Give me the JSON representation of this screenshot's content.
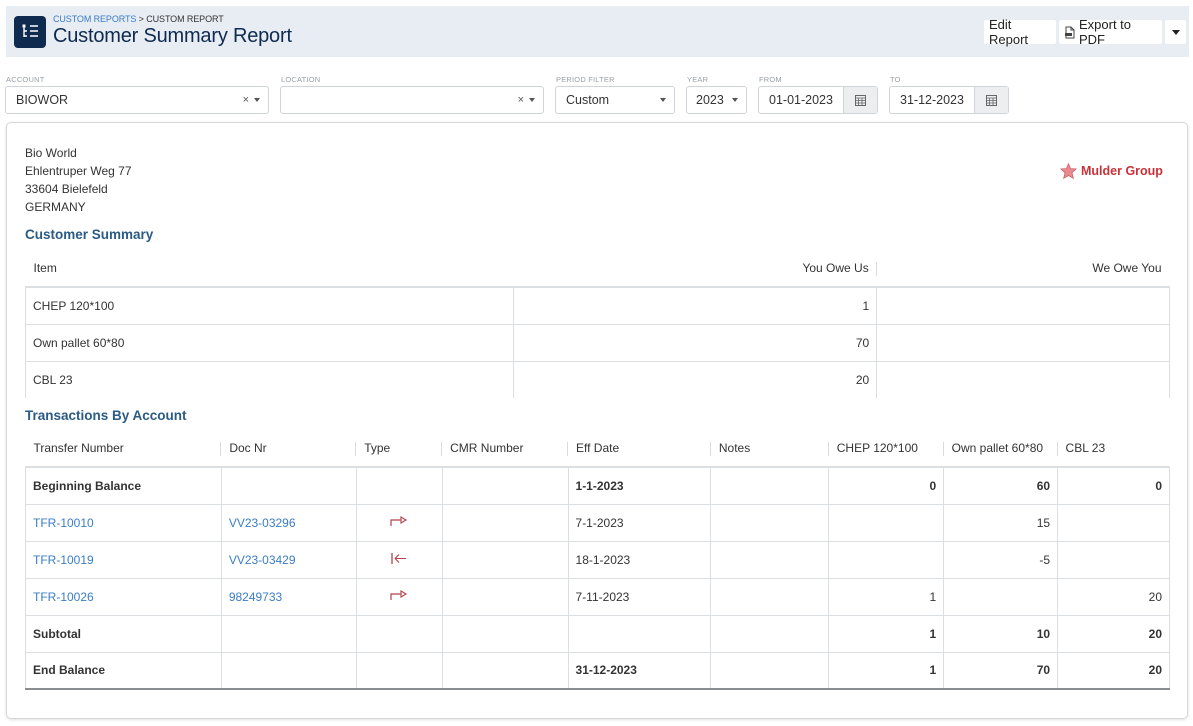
{
  "header": {
    "breadcrumb": {
      "parent": "CUSTOM REPORTS",
      "separator": " > ",
      "current": "CUSTOM REPORT"
    },
    "title": "Customer Summary Report",
    "app_icon": "tree-list-icon",
    "buttons": {
      "edit": "Edit Report",
      "export": "Export to PDF",
      "export_icon": "pdf-file-icon",
      "more_icon": "caret-down-icon"
    }
  },
  "filters": {
    "account": {
      "label": "ACCOUNT",
      "value": "BIOWOR",
      "clear_symbol": "×"
    },
    "location": {
      "label": "LOCATION",
      "value": "",
      "clear_symbol": "×"
    },
    "period": {
      "label": "PERIOD FILTER",
      "value": "Custom"
    },
    "year": {
      "label": "YEAR",
      "value": "2023"
    },
    "from": {
      "label": "FROM",
      "value": "01-01-2023",
      "icon": "calendar-icon"
    },
    "to": {
      "label": "TO",
      "value": "31-12-2023",
      "icon": "calendar-icon"
    }
  },
  "report": {
    "address": {
      "name": "Bio World",
      "street": "Ehlentruper Weg 77",
      "city": "33604 Bielefeld",
      "country": "GERMANY"
    },
    "logo": {
      "text": "Mulder Group",
      "icon": "star-icon",
      "color": "#c8323a"
    },
    "summary": {
      "title": "Customer Summary",
      "columns": [
        "Item",
        "You Owe Us",
        "We Owe You"
      ],
      "rows": [
        {
          "item": "CHEP 120*100",
          "you_owe_us": "1",
          "we_owe_you": ""
        },
        {
          "item": "Own pallet 60*80",
          "you_owe_us": "70",
          "we_owe_you": ""
        },
        {
          "item": "CBL 23",
          "you_owe_us": "20",
          "we_owe_you": ""
        }
      ]
    },
    "transactions": {
      "title": "Transactions By Account",
      "columns": [
        "Transfer Number",
        "Doc Nr",
        "Type",
        "CMR Number",
        "Eff Date",
        "Notes",
        "CHEP 120*100",
        "Own pallet 60*80",
        "CBL 23"
      ],
      "rows": [
        {
          "transfer": "Beginning Balance",
          "doc": "",
          "type": "",
          "cmr": "",
          "date": "1-1-2023",
          "notes": "",
          "chep": "0",
          "own": "60",
          "cbl": "0",
          "bold": true
        },
        {
          "transfer": "TFR-10010",
          "doc": "VV23-03296",
          "type": "outgoing",
          "cmr": "",
          "date": "7-1-2023",
          "notes": "",
          "chep": "",
          "own": "15",
          "cbl": "",
          "link": true
        },
        {
          "transfer": "TFR-10019",
          "doc": "VV23-03429",
          "type": "incoming",
          "cmr": "",
          "date": "18-1-2023",
          "notes": "",
          "chep": "",
          "own": "-5",
          "cbl": "",
          "link": true
        },
        {
          "transfer": "TFR-10026",
          "doc": "98249733",
          "type": "outgoing",
          "cmr": "",
          "date": "7-11-2023",
          "notes": "",
          "chep": "1",
          "own": "",
          "cbl": "20",
          "link": true
        },
        {
          "transfer": "Subtotal",
          "doc": "",
          "type": "",
          "cmr": "",
          "date": "",
          "notes": "",
          "chep": "1",
          "own": "10",
          "cbl": "20",
          "bold": true
        },
        {
          "transfer": "End Balance",
          "doc": "",
          "type": "",
          "cmr": "",
          "date": "31-12-2023",
          "notes": "",
          "chep": "1",
          "own": "70",
          "cbl": "20",
          "bold": true
        }
      ]
    }
  },
  "colors": {
    "header_bg": "#e8edf4",
    "title": "#0e2a4f",
    "link": "#3b7dc4",
    "section": "#2b5b84",
    "type_icon": "#b5414a"
  }
}
